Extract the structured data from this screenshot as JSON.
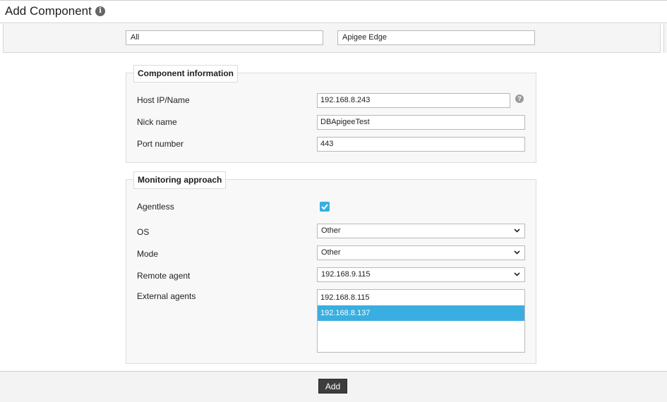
{
  "header": {
    "title": "Add Component"
  },
  "top_filters": {
    "left_value": "All",
    "right_value": "Apigee Edge"
  },
  "component_info": {
    "legend": "Component information",
    "host_label": "Host IP/Name",
    "host_value": "192.168.8.243",
    "nick_label": "Nick name",
    "nick_value": "DBApigeeTest",
    "port_label": "Port number",
    "port_value": "443"
  },
  "monitoring": {
    "legend": "Monitoring approach",
    "agentless_label": "Agentless",
    "agentless_checked": true,
    "os_label": "OS",
    "os_value": "Other",
    "mode_label": "Mode",
    "mode_value": "Other",
    "remote_label": "Remote agent",
    "remote_value": "192.168.9.115",
    "external_label": "External agents",
    "external_agents": [
      {
        "value": "192.168.8.115",
        "selected": false
      },
      {
        "value": "192.168.8.137",
        "selected": true
      }
    ]
  },
  "footer": {
    "add_label": "Add"
  },
  "colors": {
    "accent": "#3aaee0",
    "button": "#3d3d3d"
  },
  "icons": {
    "info": "info-icon",
    "help": "help-icon",
    "check": "check-icon",
    "chevron": "chevron-down-icon"
  }
}
